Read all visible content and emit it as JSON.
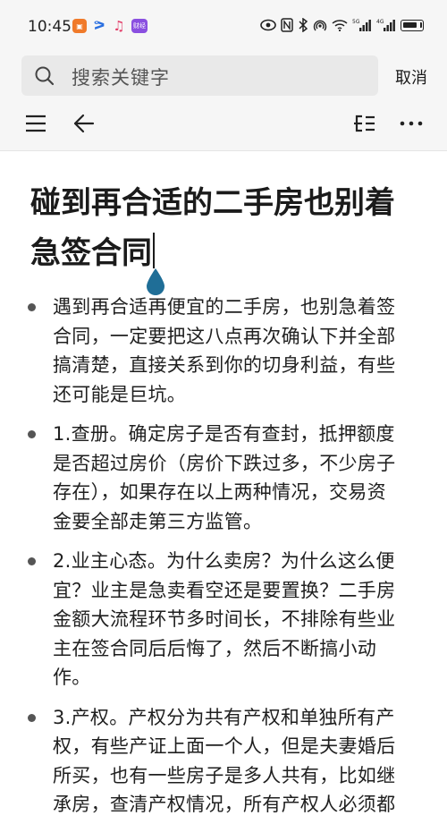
{
  "status_bar": {
    "time": "10:45",
    "app_icons": [
      "orange-app-icon",
      "v-app-icon",
      "music-note-icon",
      "purple-app-icon"
    ],
    "purple_app_text": "财经",
    "right_icons": [
      "eye-icon",
      "nfc-icon",
      "bluetooth-icon",
      "hotspot-icon",
      "wifi-icon",
      "signal-5g-icon",
      "signal-4g-icon",
      "battery-icon"
    ],
    "signal_1": "5G",
    "signal_2": "4G"
  },
  "search": {
    "placeholder": "搜索关键字",
    "cancel_label": "取消"
  },
  "toolbar": {
    "left_icons": [
      "menu-icon",
      "back-arrow-icon"
    ],
    "right_icons": [
      "outline-icon",
      "more-icon"
    ]
  },
  "article": {
    "title": "碰到再合适的二手房也别着急签合同",
    "bullets": [
      "遇到再合适再便宜的二手房，也别急着签合同，一定要把这八点再次确认下并全部搞清楚，直接关系到你的切身利益，有些还可能是巨坑。",
      "1.查册。确定房子是否有查封，抵押额度是否超过房价（房价下跌过多，不少房子存在），如果存在以上两种情况，交易资金要全部走第三方监管。",
      "2.业主心态。为什么卖房？为什么这么便宜？业主是急卖看空还是要置换？二手房金额大流程环节多时间长，不排除有些业主在签合同后后悔了，然后不断搞小动作。",
      "3.产权。产权分为共有产权和单独所有产权，有些产证上面一个人，但是夫妻婚后所买，也有一些房子是多人共有，比如继承房，查清产权情况，所有产权人必须都要在合同上签字。"
    ]
  },
  "colors": {
    "accent_handle": "#1f6e97",
    "chrome_bg": "#f6f6f6",
    "search_bg": "#e9e9e9"
  }
}
